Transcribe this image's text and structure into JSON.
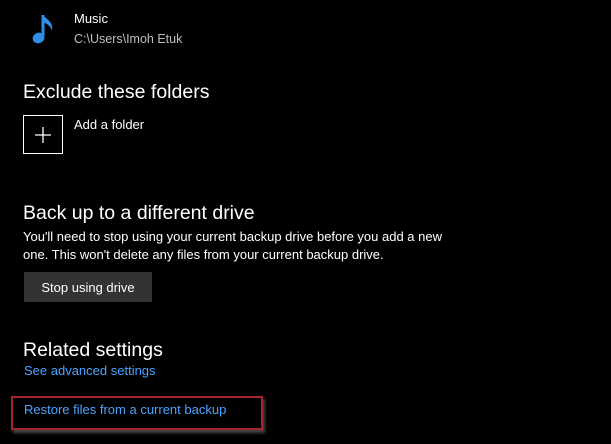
{
  "folder": {
    "name": "Music",
    "path": "C:\\Users\\Imoh Etuk",
    "icon": "music-note-icon"
  },
  "exclude": {
    "heading": "Exclude these folders",
    "add_label": "Add a folder",
    "add_icon": "plus-icon"
  },
  "different_drive": {
    "heading": "Back up to a different drive",
    "description": "You'll need to stop using your current backup drive before you add a new one. This won't delete any files from your current backup drive.",
    "button_label": "Stop using drive"
  },
  "related": {
    "heading": "Related settings",
    "advanced_link": "See advanced settings",
    "restore_link": "Restore files from a current backup"
  },
  "colors": {
    "background": "#000000",
    "text": "#ffffff",
    "secondary_text": "#bfbfbf",
    "accent_icon": "#2f8fe8",
    "link": "#4ba3ff",
    "button_bg": "#333333",
    "highlight_border": "#a4262c"
  }
}
